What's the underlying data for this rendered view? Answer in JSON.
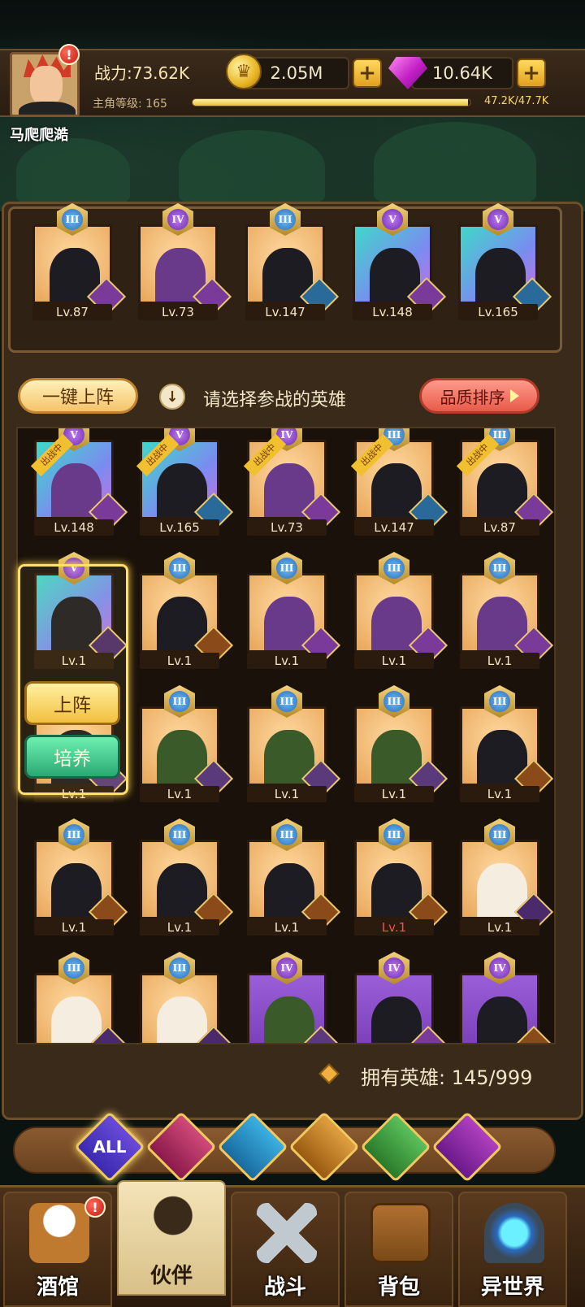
{
  "header": {
    "power_label": "战力:73.62K",
    "level_label": "主角等级: 165",
    "xp_text": "47.2K/47.7K",
    "xp_progress": 0.99,
    "gold": "2.05M",
    "gems": "10.64K",
    "player_name": "马爬爬澔",
    "alert": "!"
  },
  "lineup": [
    {
      "rank": "III",
      "level": "Lv.87",
      "quality": "gold",
      "faction": "demon"
    },
    {
      "rank": "IV",
      "level": "Lv.73",
      "quality": "gold",
      "faction": "demon"
    },
    {
      "rank": "III",
      "level": "Lv.147",
      "quality": "gold",
      "faction": "water"
    },
    {
      "rank": "V",
      "level": "Lv.148",
      "quality": "blue",
      "faction": "demon"
    },
    {
      "rank": "V",
      "level": "Lv.165",
      "quality": "blue",
      "faction": "water"
    }
  ],
  "actions": {
    "one_click_label": "一键上阵",
    "hint": "请选择参战的英雄",
    "sort_label": "品质排序"
  },
  "deploy_tag": "出战中",
  "grid_rows": [
    [
      {
        "rank": "V",
        "level": "Lv.148",
        "deployed": true
      },
      {
        "rank": "V",
        "level": "Lv.165",
        "deployed": true
      },
      {
        "rank": "IV",
        "level": "Lv.73",
        "deployed": true
      },
      {
        "rank": "III",
        "level": "Lv.147",
        "deployed": true
      },
      {
        "rank": "III",
        "level": "Lv.87",
        "deployed": true
      }
    ],
    [
      {
        "rank": "V",
        "level": "Lv.1",
        "selected": true
      },
      {
        "rank": "III",
        "level": "Lv.1"
      },
      {
        "rank": "III",
        "level": "Lv.1"
      },
      {
        "rank": "III",
        "level": "Lv.1"
      },
      {
        "rank": "III",
        "level": "Lv.1"
      }
    ],
    [
      {
        "rank": "",
        "level": "Lv.1"
      },
      {
        "rank": "III",
        "level": "Lv.1"
      },
      {
        "rank": "III",
        "level": "Lv.1"
      },
      {
        "rank": "III",
        "level": "Lv.1"
      },
      {
        "rank": "III",
        "level": "Lv.1"
      }
    ],
    [
      {
        "rank": "III",
        "level": "Lv.1"
      },
      {
        "rank": "III",
        "level": "Lv.1"
      },
      {
        "rank": "III",
        "level": "Lv.1"
      },
      {
        "rank": "III",
        "level": "Lv.1",
        "red": true
      },
      {
        "rank": "III",
        "level": "Lv.1"
      }
    ],
    [
      {
        "rank": "III",
        "level": ""
      },
      {
        "rank": "III",
        "level": ""
      },
      {
        "rank": "IV",
        "level": ""
      },
      {
        "rank": "IV",
        "level": ""
      },
      {
        "rank": "IV",
        "level": ""
      }
    ]
  ],
  "popup": {
    "deploy_label": "上阵",
    "train_label": "培养"
  },
  "owned": {
    "label": "拥有英雄:",
    "count": "145/999"
  },
  "filters": [
    {
      "label": "ALL",
      "icon": "all-filter"
    },
    {
      "label": "",
      "icon": "crown-faction-icon"
    },
    {
      "label": "",
      "icon": "water-faction-icon"
    },
    {
      "label": "",
      "icon": "beast-faction-icon"
    },
    {
      "label": "",
      "icon": "elf-faction-icon"
    },
    {
      "label": "",
      "icon": "demon-faction-icon"
    }
  ],
  "nav": [
    {
      "label": "酒馆",
      "icon": "beer-mug-icon",
      "alert": true
    },
    {
      "label": "伙伴",
      "icon": "partner-icon",
      "active": true
    },
    {
      "label": "战斗",
      "icon": "crossed-swords-icon"
    },
    {
      "label": "背包",
      "icon": "chest-icon"
    },
    {
      "label": "异世界",
      "icon": "portal-icon"
    }
  ]
}
